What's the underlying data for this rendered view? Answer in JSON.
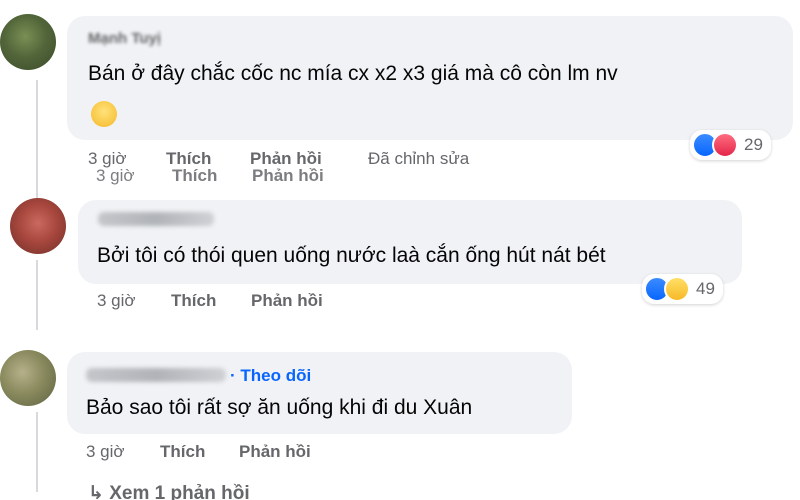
{
  "comments": [
    {
      "author": "Mạnh Tuyị",
      "text": "Bán ở đây chắc cốc nc mía cx x2 x3 giá mà cô còn lm nv",
      "time": "3 giờ",
      "like": "Thích",
      "reply": "Phản hồi",
      "edited": "Đã chỉnh sửa",
      "ghost_time": "3 giờ",
      "ghost_like": "Thích",
      "ghost_reply": "Phản hồi",
      "reaction_count": "29",
      "reactions": [
        "like",
        "love"
      ]
    },
    {
      "text": "Bởi tôi có thói quen uống nước laà cắn ống hút nát bét",
      "time": "3 giờ",
      "like": "Thích",
      "reply": "Phản hồi",
      "reaction_count": "49",
      "reactions": [
        "like",
        "haha"
      ]
    },
    {
      "follow": "· Theo dõi",
      "text": "Bảo sao tôi rất sợ ăn uống khi đi du Xuân",
      "time": "3 giờ",
      "like": "Thích",
      "reply": "Phản hồi",
      "view_replies": "Xem 1 phản hồi"
    }
  ],
  "colors": {
    "accent": "#0866ff",
    "bubble": "#f0f2f5",
    "meta": "#65676b"
  }
}
